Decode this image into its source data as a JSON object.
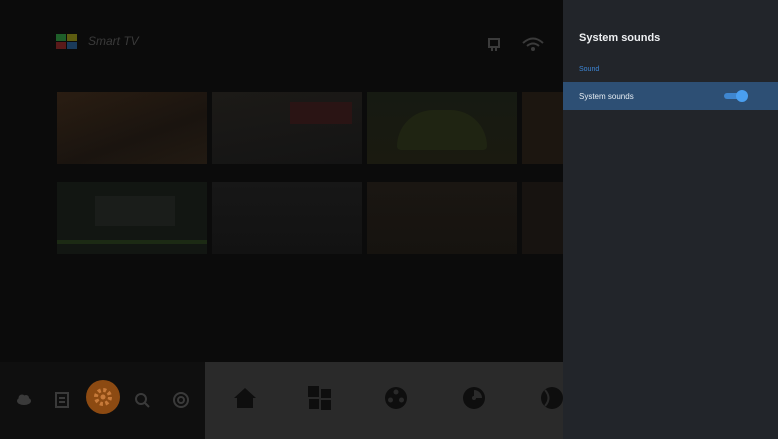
{
  "header": {
    "brand": "Smart TV"
  },
  "panel": {
    "title": "System sounds",
    "section": "Sound",
    "row_label": "System sounds",
    "toggle_on": true
  },
  "dock": {
    "icons": [
      "home-icon",
      "apps-icon",
      "film-reel-icon",
      "media-disc-icon",
      "sports-ball-icon"
    ]
  },
  "left_bar": {
    "icons": [
      "cloud-icon",
      "input-icon",
      "settings-gear-icon",
      "search-icon",
      "broadcast-icon"
    ]
  },
  "colors": {
    "accent": "#3f86cf",
    "panel_bg": "#22252a",
    "highlight_row": "#2d4f74",
    "settings_orange": "#8c4a12"
  }
}
